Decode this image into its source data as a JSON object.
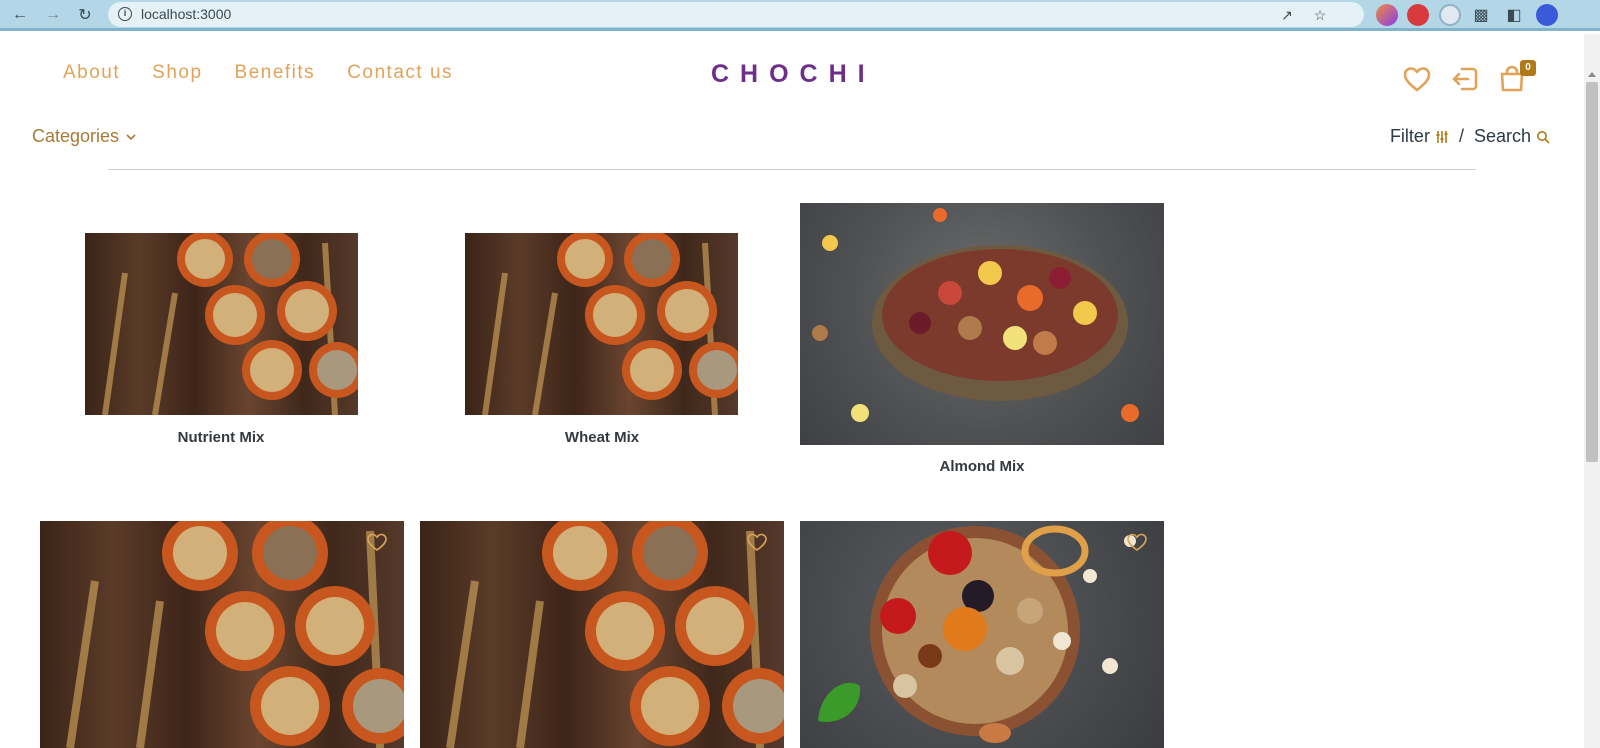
{
  "browser": {
    "url": "localhost:3000"
  },
  "nav": {
    "links": [
      "About",
      "Shop",
      "Benefits",
      "Contact us"
    ]
  },
  "brand": "CHOCHI",
  "cart": {
    "count": "0"
  },
  "toolbar": {
    "categories": "Categories",
    "filter": "Filter",
    "separator": "/",
    "search": "Search"
  },
  "products": [
    {
      "name": "Nutrient Mix"
    },
    {
      "name": "Wheat Mix"
    },
    {
      "name": "Almond Mix"
    },
    {
      "name": ""
    },
    {
      "name": ""
    },
    {
      "name": ""
    }
  ],
  "colors": {
    "accent": "#e0a35a",
    "brand": "#6e2f8a",
    "category": "#a87a36"
  }
}
